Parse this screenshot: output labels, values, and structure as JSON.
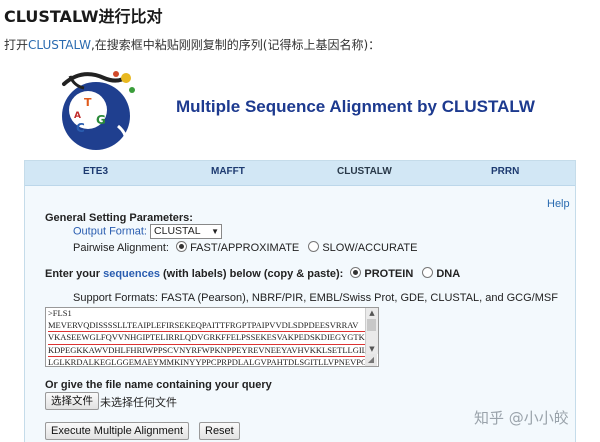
{
  "heading": "CLUSTALW进行比对",
  "instruction": {
    "prefix": "打开",
    "link": "CLUSTALW",
    "suffix": ",在搜索框中粘贴刚刚复制的序列(记得标上基因名称)："
  },
  "banner": {
    "title": "Multiple Sequence Alignment by CLUSTALW",
    "logo_letters": [
      "T",
      "G",
      "C",
      "A"
    ]
  },
  "tabs": [
    {
      "label": "ETE3"
    },
    {
      "label": "MAFFT"
    },
    {
      "label": "CLUSTALW",
      "active": true
    },
    {
      "label": "PRRN"
    }
  ],
  "help": "Help",
  "general": {
    "title": "General Setting Parameters:",
    "output_format_label": "Output Format:",
    "output_format_value": "CLUSTAL",
    "pairwise_label": "Pairwise Alignment:",
    "pairwise_options": [
      "FAST/APPROXIMATE",
      "SLOW/ACCURATE"
    ],
    "pairwise_selected": "FAST/APPROXIMATE"
  },
  "sequences": {
    "prefix": "Enter your ",
    "link": "sequences",
    "suffix": " (with labels) below (copy & paste):",
    "type_options": [
      "PROTEIN",
      "DNA"
    ],
    "type_selected": "PROTEIN",
    "support_formats": "Support Formats: FASTA (Pearson), NBRF/PIR, EMBL/Swiss Prot, GDE, CLUSTAL, and GCG/MSF",
    "textarea_lines": [
      ">FLS1",
      "MEVERVQDISSSSLLTEAIPLEFIRSEKEQPAITTFRGPTPAIPVVDLSDPDEESVRRAV",
      "VKASEEWGLFQVVNHGIPTELIRRLQDVGRKFFELPSSEKESVAKPEDSKDIEGYGTKLQ",
      "KDPEGKKAWVDHLFHRIWPPSCVNYRFWPKNPPEYREVNEEYAVHVKKLSETLLGILSDG",
      "LGLKRDALKEGLGGEMAEYMMKINYYPPCPRPDLALGVPAHTDLSGITLLVPNEVPGLQV"
    ]
  },
  "file": {
    "label": "Or give the file name containing your query",
    "choose_button": "选择文件",
    "no_file": "未选择任何文件"
  },
  "actions": {
    "execute": "Execute Multiple Alignment",
    "reset": "Reset"
  },
  "watermark": {
    "site": "知乎",
    "handle": "@小小皎"
  },
  "colors": {
    "title_blue": "#1d3a8f",
    "link_blue": "#2a6bb0",
    "panel_bg": "#f3f9fd",
    "tab_bg": "#d2e7f5"
  }
}
